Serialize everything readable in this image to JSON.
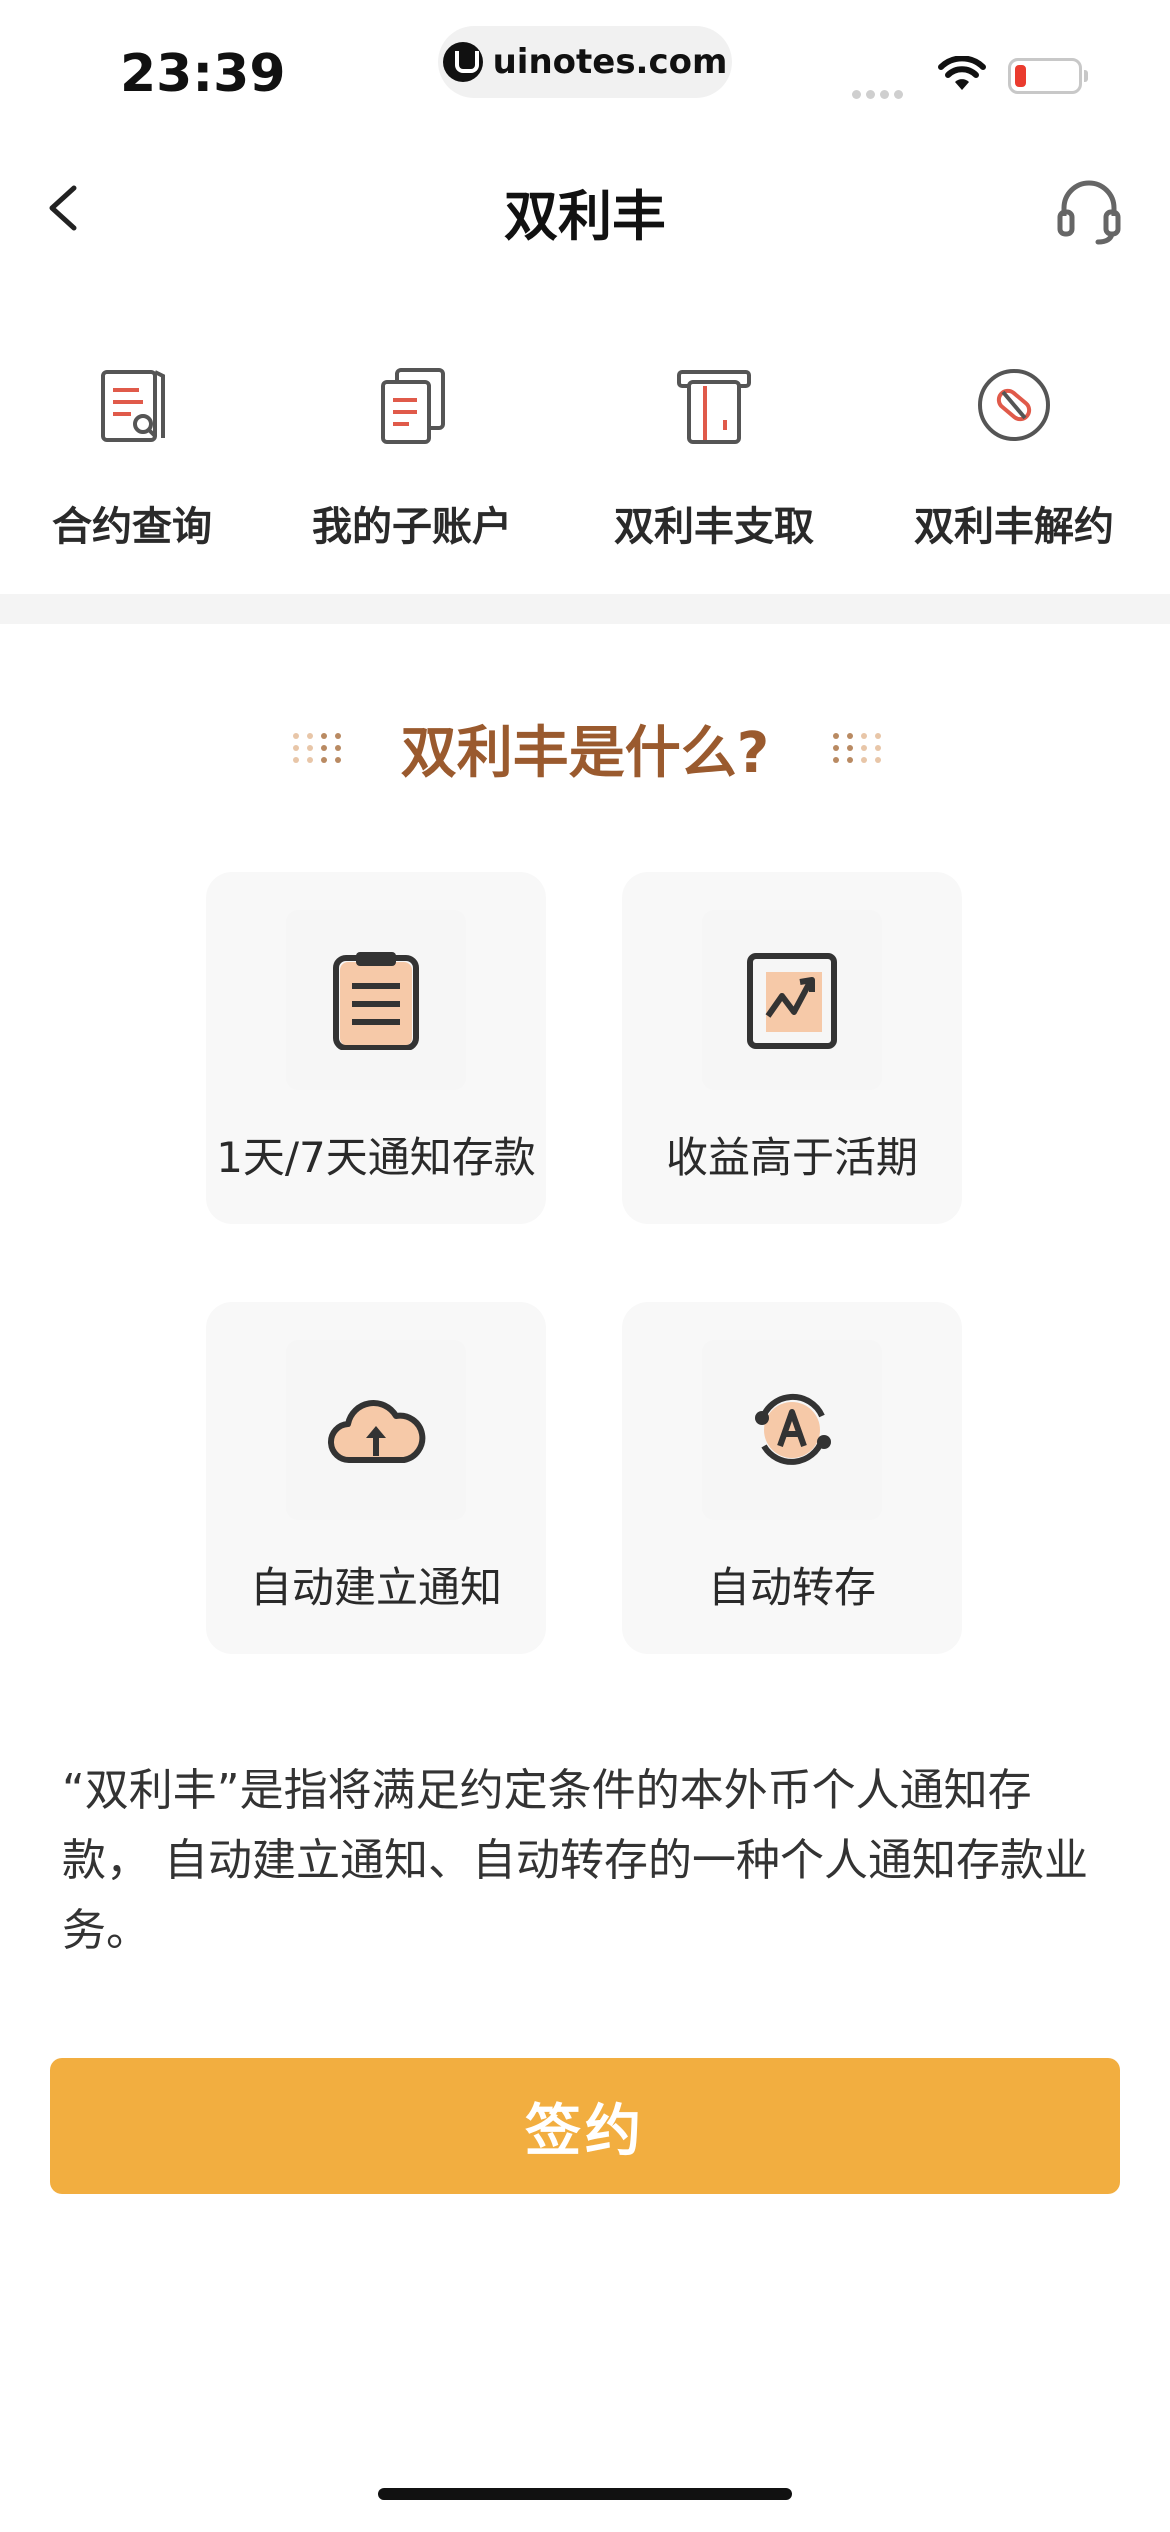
{
  "status_bar": {
    "time": "23:39",
    "url": "uinotes.com",
    "battery_color": "#ea3b2e"
  },
  "nav": {
    "title": "双利丰",
    "back_icon": "chevron-left-icon",
    "service_icon": "headset-icon"
  },
  "quick_actions": [
    {
      "label": "合约查询",
      "icon": "contract-search-icon"
    },
    {
      "label": "我的子账户",
      "icon": "sub-account-icon"
    },
    {
      "label": "双利丰支取",
      "icon": "withdraw-icon"
    },
    {
      "label": "双利丰解约",
      "icon": "terminate-icon"
    }
  ],
  "section": {
    "title": "双利丰是什么?"
  },
  "features": [
    {
      "label": "1天/7天通知存款",
      "icon": "clipboard-icon"
    },
    {
      "label": "收益高于活期",
      "icon": "trend-up-icon"
    },
    {
      "label": "自动建立通知",
      "icon": "cloud-upload-icon"
    },
    {
      "label": "自动转存",
      "icon": "auto-rollover-icon"
    }
  ],
  "description": "“双利丰”是指将满足约定条件的本外币个人通知存款， 自动建立通知、自动转存的一种个人通知存款业务。",
  "sign_button": {
    "label": "签约",
    "color": "#f2ae40"
  },
  "colors": {
    "accent": "#f2ae40",
    "heading": "#9a5a2e",
    "icon_fill": "#f6c9a8",
    "icon_red": "#e05a4a"
  }
}
